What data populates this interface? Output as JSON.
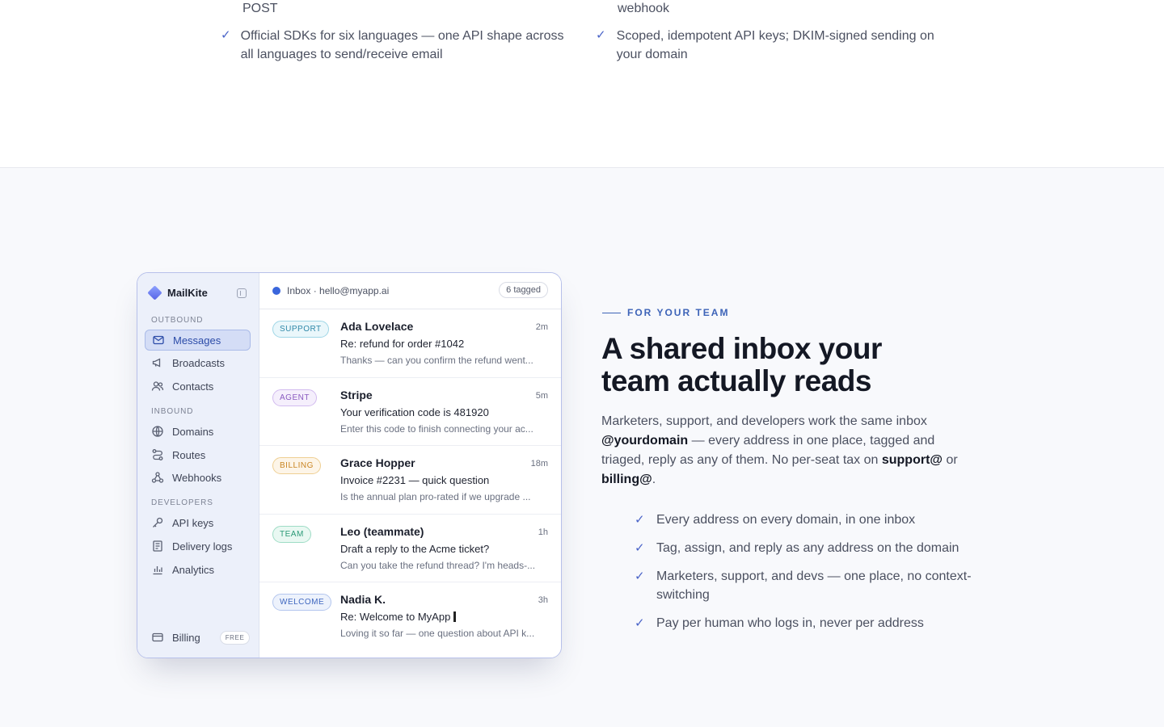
{
  "top": {
    "left_fragment": "POST",
    "right_fragment": "webhook",
    "features": [
      "Official SDKs for six languages — one API shape across all languages to send/receive email",
      "Scoped, idempotent API keys; DKIM-signed sending on your domain"
    ]
  },
  "app": {
    "brand": "MailKite",
    "sections": {
      "outbound": "OUTBOUND",
      "inbound": "INBOUND",
      "developers": "DEVELOPERS"
    },
    "nav": {
      "messages": "Messages",
      "broadcasts": "Broadcasts",
      "contacts": "Contacts",
      "domains": "Domains",
      "routes": "Routes",
      "webhooks": "Webhooks",
      "api_keys": "API keys",
      "delivery_logs": "Delivery logs",
      "analytics": "Analytics",
      "billing": "Billing",
      "billing_badge": "FREE"
    },
    "header": {
      "inbox": "Inbox · hello@myapp.ai",
      "tagged": "6 tagged"
    },
    "messages": [
      {
        "tag": "SUPPORT",
        "from": "Ada Lovelace",
        "time": "2m",
        "subject": "Re: refund for order #1042",
        "preview": "Thanks — can you confirm the refund went..."
      },
      {
        "tag": "AGENT",
        "from": "Stripe",
        "time": "5m",
        "subject": "Your verification code is 481920",
        "preview": "Enter this code to finish connecting your ac..."
      },
      {
        "tag": "BILLING",
        "from": "Grace Hopper",
        "time": "18m",
        "subject": "Invoice #2231 — quick question",
        "preview": "Is the annual plan pro-rated if we upgrade ..."
      },
      {
        "tag": "TEAM",
        "from": "Leo (teammate)",
        "time": "1h",
        "subject": "Draft a reply to the Acme ticket?",
        "preview": "Can you take the refund thread? I'm heads-..."
      },
      {
        "tag": "WELCOME",
        "from": "Nadia K.",
        "time": "3h",
        "subject": "Re: Welcome to MyApp",
        "preview": "Loving it so far — one question about API k..."
      }
    ]
  },
  "copy": {
    "eyebrow": "FOR YOUR TEAM",
    "headline_line1": "A shared inbox your",
    "headline_line2": "team actually reads",
    "body_part1": "Marketers, support, and developers work the same inbox ",
    "body_bold1": "@yourdomain",
    "body_part2": " — every address in one place, tagged and triaged, reply as any of them. No per-seat tax on ",
    "body_bold2": "support@",
    "body_part3": " or ",
    "body_bold3": "billing@",
    "body_part4": ".",
    "bullets": [
      "Every address on every domain, in one inbox",
      "Tag, assign, and reply as any address on the domain",
      "Marketers, support, and devs — one place, no context-switching",
      "Pay per human who logs in, never per address"
    ]
  },
  "colors": {
    "accent": "#3e64b8",
    "check": "#4a64c8",
    "active_nav": "#d4ddf6"
  }
}
